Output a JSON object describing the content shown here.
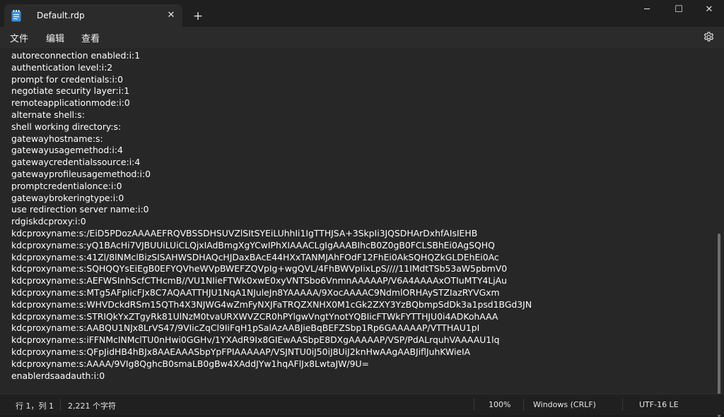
{
  "tab": {
    "title": "Default.rdp",
    "close_glyph": "✕",
    "icon": "notepad-icon"
  },
  "new_tab_glyph": "+",
  "window_controls": {
    "minimize": "─",
    "maximize": "☐",
    "close": "✕"
  },
  "menu": {
    "file": "文件",
    "edit": "编辑",
    "view": "查看",
    "settings_icon": "gear-icon"
  },
  "editor_lines": [
    "autoreconnection enabled:i:1",
    "authentication level:i:2",
    "prompt for credentials:i:0",
    "negotiate security layer:i:1",
    "remoteapplicationmode:i:0",
    "alternate shell:s:",
    "shell working directory:s:",
    "gatewayhostname:s:",
    "gatewayusagemethod:i:4",
    "gatewaycredentialssource:i:4",
    "gatewayprofileusagemethod:i:0",
    "promptcredentialonce:i:0",
    "gatewaybrokeringtype:i:0",
    "use redirection server name:i:0",
    "rdgiskdcproxy:i:0",
    "kdcproxyname:s:/EiD5PDozAAAAEFRQVBSSDHSUVZlSItSYEiLUhhIi1IgTTHJSA+3SkpIi3JQSDHArDxhfAIsIEHB",
    "kdcproxyname:s:yQ1BAcHi7VJBUUiLUiCLQjxIAdBmgXgYCwIPhXIAAACLgIgAAABIhcB0Z0gB0FCLSBhEi0AgSQHQ",
    "kdcproxyname:s:41Zl/8lNMclBizSISAHWSDHAQcHJDaxBAcE44HXxTANMJAhFOdF12FhEi0AkSQHQZkGLDEhEi0Ac",
    "kdcproxyname:s:SQHQQYsEiEgB0EFYQVheWVpBWEFZQVpIg+wgQVL/4FhBWVpIixLpS////11IMdtTSb53aW5pbmV0",
    "kdcproxyname:s:AEFWSInhScfCTHcmB//VU1NIieFTWk0xwE0xyVNTSbo6VnmnAAAAAP/V6A4AAAAxOTIuMTY4LjAu",
    "kdcproxyname:s:MTg5AFpIicFJx8C7AQAATTHJU1NqA1NJuleJn8YAAAAA/9XocAAAAC9NdmlORHAySTZIazRYVGxm",
    "kdcproxyname:s:WHVDckdRSm15QTh4X3NJWG4wZmFyNXJFaTRQZXNHX0M1cGk2ZXY3YzBQbmpSdDk3a1psd1BGd3JN",
    "kdcproxyname:s:STRIQkYxZTgyRk81UlNzM0tvaURXWVZCR0hPYlgwVngtYnotYQBIicFTWkFYTTHJU0i4ADKohAAA",
    "kdcproxyname:s:AABQU1NJx8LrVS47/9VIicZqCl9IiFqH1pSalAzAABJieBqBEFZSbp1Rp6GAAAAAP/VTTHAU1pI",
    "kdcproxyname:s:iFFNMcINMclTU0nHwi0GGHv/1YXAdR9Ix8GIEwAASbpE8DXgAAAAAP/VSP/PdALrquhVAAAAU1lq",
    "kdcproxyname:s:QFpJidHB4hBJx8AAEAAASbpYpFPIAAAAAP/VSJNTU0iJ50iJ8UiJ2knHwAAgAABJiflJuhKWieIA",
    "kdcproxyname:s:AAAA/9VIg8QghcB0smaLB0gBw4XAddJYw1hqAFlJx8LwtaJW/9U=",
    "enablerdsaadauth:i:0"
  ],
  "status": {
    "position": "行 1，列 1",
    "char_count": "2,221 个字符",
    "zoom": "100%",
    "line_ending": "Windows (CRLF)",
    "encoding": "UTF-16 LE"
  }
}
